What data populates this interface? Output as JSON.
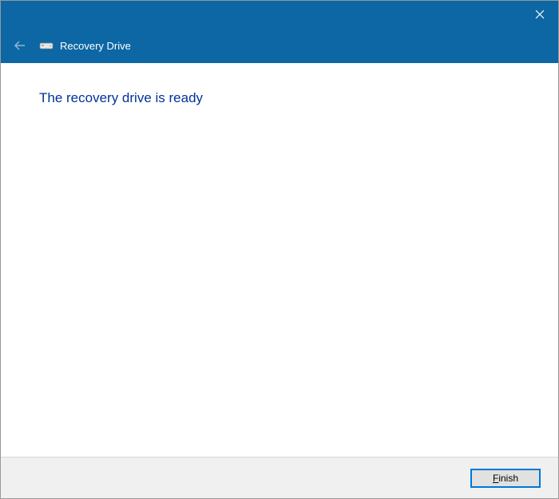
{
  "titlebar": {
    "close_icon": "close"
  },
  "header": {
    "back_icon": "back",
    "drive_icon": "drive",
    "title": "Recovery Drive"
  },
  "content": {
    "heading": "The recovery drive is ready"
  },
  "footer": {
    "finish_label": "Finish",
    "finish_mnemonic": "F"
  },
  "colors": {
    "header_bg": "#0c67a4",
    "heading_text": "#003399",
    "footer_bg": "#f0f0f0",
    "button_focus_border": "#0078d7"
  }
}
